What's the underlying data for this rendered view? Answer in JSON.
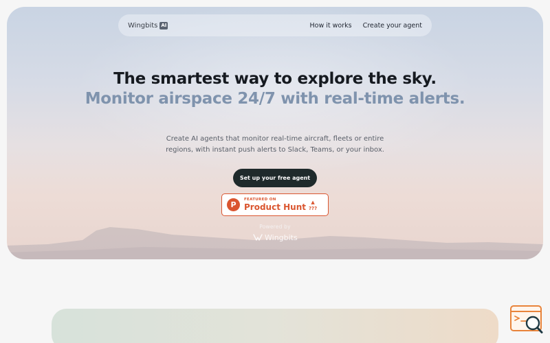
{
  "brand": {
    "name": "Wingbits",
    "badge": "AI"
  },
  "nav": {
    "links": [
      {
        "label": "How it works"
      },
      {
        "label": "Create your agent"
      }
    ]
  },
  "hero": {
    "headline": "The smartest way to explore the sky.",
    "subheadline": "Monitor airspace 24/7 with real-time alerts.",
    "description": "Create AI agents that monitor real-time aircraft, fleets or entire regions, with instant push alerts to Slack, Teams, or your inbox.",
    "cta_label": "Set up your free agent",
    "product_hunt": {
      "featured_label": "FEATURED ON",
      "name": "Product Hunt",
      "logo_letter": "P",
      "arrow": "▲",
      "votes": "???"
    },
    "powered_by": "Powered by",
    "powered_brand": "Wingbits"
  },
  "widget": {
    "icon": "search-document-icon"
  },
  "colors": {
    "accent_dark": "#1f2a2b",
    "subheadline": "#7f93ad",
    "product_hunt": "#da552f",
    "widget_orange": "#e8833a"
  }
}
